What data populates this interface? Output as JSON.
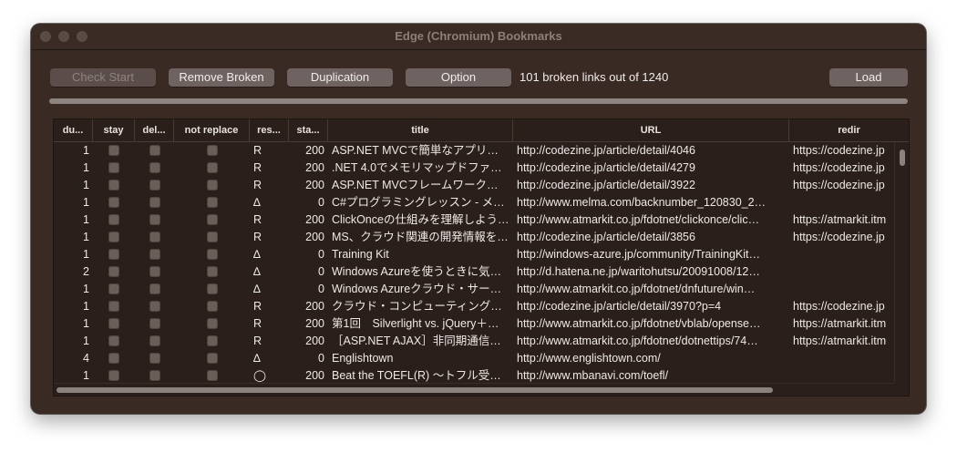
{
  "window": {
    "title": "Edge (Chromium) Bookmarks"
  },
  "toolbar": {
    "check_start": "Check Start",
    "remove_broken": "Remove Broken",
    "duplication": "Duplication",
    "option": "Option",
    "status": "101 broken links out of 1240",
    "load": "Load"
  },
  "progress": {
    "value_percent": 100
  },
  "table": {
    "headers": [
      "du...",
      "stay",
      "del...",
      "not replace",
      "res...",
      "sta...",
      "title",
      "URL",
      "redir"
    ],
    "rows": [
      {
        "dup": "1",
        "res": "R",
        "status": "200",
        "title": "ASP.NET MVCで簡単なアプリケ…",
        "url": "http://codezine.jp/article/detail/4046",
        "redir": "https://codezine.jp"
      },
      {
        "dup": "1",
        "res": "R",
        "status": "200",
        "title": ".NET 4.0でメモリマップドファ…",
        "url": "http://codezine.jp/article/detail/4279",
        "redir": "https://codezine.jp"
      },
      {
        "dup": "1",
        "res": "R",
        "status": "200",
        "title": "ASP.NET MVCフレームワークの…",
        "url": "http://codezine.jp/article/detail/3922",
        "redir": "https://codezine.jp"
      },
      {
        "dup": "1",
        "res": "∆",
        "status": "0",
        "title": "C#プログラミングレッスン - メ…",
        "url": "http://www.melma.com/backnumber_120830_2…",
        "redir": ""
      },
      {
        "dup": "1",
        "res": "R",
        "status": "200",
        "title": "ClickOnceの仕組みを理解しよう…",
        "url": "http://www.atmarkit.co.jp/fdotnet/clickonce/clic…",
        "redir": "https://atmarkit.itm"
      },
      {
        "dup": "1",
        "res": "R",
        "status": "200",
        "title": "MS、クラウド関連の開発情報を…",
        "url": "http://codezine.jp/article/detail/3856",
        "redir": "https://codezine.jp"
      },
      {
        "dup": "1",
        "res": "∆",
        "status": "0",
        "title": "Training Kit",
        "url": "http://windows-azure.jp/community/TrainingKit…",
        "redir": ""
      },
      {
        "dup": "2",
        "res": "∆",
        "status": "0",
        "title": "Windows Azureを使うときに気…",
        "url": "http://d.hatena.ne.jp/waritohutsu/20091008/12…",
        "redir": ""
      },
      {
        "dup": "1",
        "res": "∆",
        "status": "0",
        "title": "Windows Azureクラウド・サー…",
        "url": "http://www.atmarkit.co.jp/fdotnet/dnfuture/win…",
        "redir": ""
      },
      {
        "dup": "1",
        "res": "R",
        "status": "200",
        "title": "クラウド・コンピューティングの…",
        "url": "http://codezine.jp/article/detail/3970?p=4",
        "redir": "https://codezine.jp"
      },
      {
        "dup": "1",
        "res": "R",
        "status": "200",
        "title": "第1回　Silverlight vs. jQuery＋…",
        "url": "http://www.atmarkit.co.jp/fdotnet/vblab/opense…",
        "redir": "https://atmarkit.itm"
      },
      {
        "dup": "1",
        "res": "R",
        "status": "200",
        "title": "［ASP.NET AJAX］非同期通信…",
        "url": "http://www.atmarkit.co.jp/fdotnet/dotnettips/74…",
        "redir": "https://atmarkit.itm"
      },
      {
        "dup": "4",
        "res": "∆",
        "status": "0",
        "title": "Englishtown",
        "url": "http://www.englishtown.com/",
        "redir": ""
      },
      {
        "dup": "1",
        "res": "◯",
        "status": "200",
        "title": "Beat the TOEFL(R) 〜トフル受…",
        "url": "http://www.mbanavi.com/toefl/",
        "redir": ""
      }
    ]
  },
  "icons": {
    "checkbox": "checkbox-icon"
  }
}
